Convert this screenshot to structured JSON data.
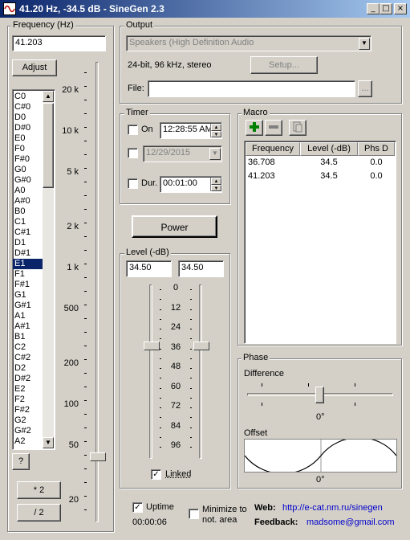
{
  "window": {
    "title": "41.20 Hz, -34.5 dB - SineGen 2.3",
    "minimize_glyph": "_",
    "maximize_glyph": "□",
    "close_glyph": "×"
  },
  "frequency": {
    "group_label": "Frequency (Hz)",
    "value": "41.203",
    "adjust_label": "Adjust",
    "help_label": "?",
    "double_label": "* 2",
    "half_label": "/ 2",
    "notes": [
      "C0",
      "C#0",
      "D0",
      "D#0",
      "E0",
      "F0",
      "F#0",
      "G0",
      "G#0",
      "A0",
      "A#0",
      "B0",
      "C1",
      "C#1",
      "D1",
      "D#1",
      "E1",
      "F1",
      "F#1",
      "G1",
      "G#1",
      "A1",
      "A#1",
      "B1",
      "C2",
      "C#2",
      "D2",
      "D#2",
      "E2",
      "F2",
      "F#2",
      "G2",
      "G#2",
      "A2"
    ],
    "selected_note": "E1",
    "scale_labels": [
      "20 k",
      "10 k",
      "5 k",
      "2 k",
      "1 k",
      "500",
      "200",
      "100",
      "50",
      "20"
    ]
  },
  "output": {
    "group_label": "Output",
    "device": "Speakers (High Definition Audio",
    "format": "24-bit, 96 kHz, stereo",
    "setup_label": "Setup...",
    "file_label": "File:",
    "file_value": "",
    "browse_label": "..."
  },
  "timer": {
    "group_label": "Timer",
    "on_label": "On",
    "on_time": "12:28:55 AM",
    "date_value": "12/29/2015",
    "dur_label": "Dur.",
    "dur_value": "00:01:00"
  },
  "power_label": "Power",
  "level": {
    "group_label": "Level (-dB)",
    "left_value": "34.50",
    "right_value": "34.50",
    "scale_labels": [
      "0",
      "12",
      "24",
      "36",
      "48",
      "60",
      "72",
      "84",
      "96"
    ],
    "linked_label": "Linked",
    "linked_checked": true
  },
  "macro": {
    "group_label": "Macro",
    "columns": [
      "Frequency",
      "Level (-dB)",
      "Phs D"
    ],
    "rows": [
      [
        "36.708",
        "34.5",
        "0.0"
      ],
      [
        "41.203",
        "34.5",
        "0.0"
      ]
    ]
  },
  "phase": {
    "group_label": "Phase",
    "difference_label": "Difference",
    "difference_value": "0°",
    "offset_label": "Offset",
    "offset_value": "0°"
  },
  "uptime": {
    "label": "Uptime",
    "checked": true,
    "value": "00:00:06"
  },
  "minimize_area_label_1": "Minimize to",
  "minimize_area_label_2": "not. area",
  "web": {
    "label": "Web:",
    "url": "http://e-cat.nm.ru/sinegen"
  },
  "feedback": {
    "label": "Feedback:",
    "email": "madsome@gmail.com"
  },
  "colors": {
    "title_start": "#0a246a",
    "title_end": "#a6caf0",
    "face": "#d4d0c8",
    "selection": "#0a246a",
    "link": "#0000cc"
  }
}
